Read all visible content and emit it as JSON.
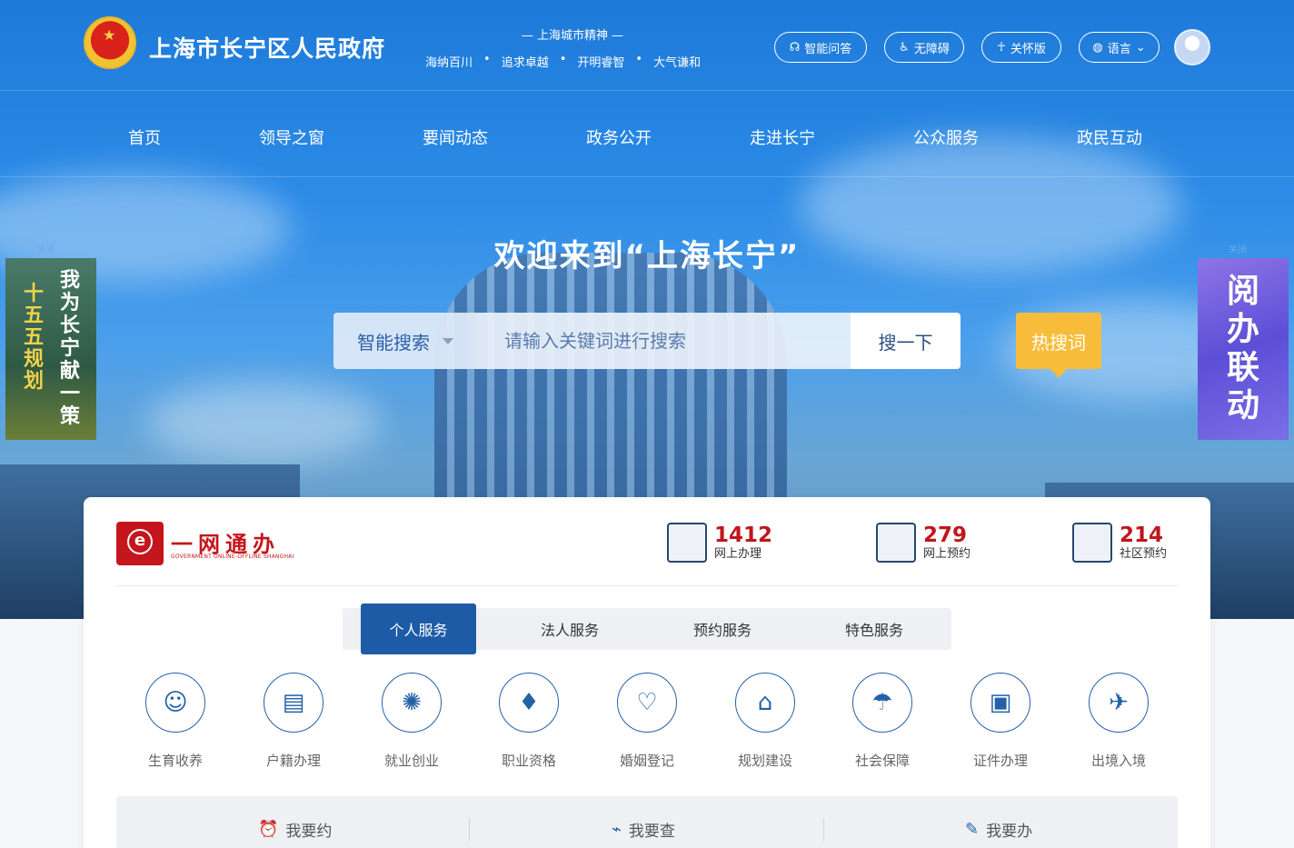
{
  "header": {
    "site_title": "上海市长宁区人民政府",
    "spirit_title": "— 上海城市精神 —",
    "spirit": [
      "海纳百川",
      "追求卓越",
      "开明睿智",
      "大气谦和"
    ],
    "tools": [
      {
        "label": "智能问答",
        "icon": "headset-icon"
      },
      {
        "label": "无障碍",
        "icon": "wheelchair-icon"
      },
      {
        "label": "关怀版",
        "icon": "elder-icon"
      },
      {
        "label": "语言",
        "icon": "globe-icon"
      }
    ]
  },
  "nav": [
    "首页",
    "领导之窗",
    "要闻动态",
    "政务公开",
    "走进长宁",
    "公众服务",
    "政民互动"
  ],
  "hero": {
    "welcome": "欢迎来到“上海长宁”",
    "search_type": "智能搜索",
    "search_placeholder": "请输入关键词进行搜索",
    "search_button": "搜一下",
    "hot_button": "热搜词"
  },
  "side_banners": {
    "close_label": "关闭",
    "left_col1": "十五五规划",
    "left_col2": "我为长宁献一策",
    "right_text": "阅办联动"
  },
  "ywtb": {
    "name": "一网通办",
    "subtitle": "GOVERNMENT ONLINE-OFFLINE SHANGHAI",
    "stats": [
      {
        "num": "1412",
        "label": "网上办理"
      },
      {
        "num": "279",
        "label": "网上预约"
      },
      {
        "num": "214",
        "label": "社区预约"
      }
    ],
    "tabs": [
      "个人服务",
      "法人服务",
      "预约服务",
      "特色服务"
    ],
    "services": [
      {
        "label": "生育收养",
        "icon": "baby-icon",
        "glyph": "☺"
      },
      {
        "label": "户籍办理",
        "icon": "id-card-icon",
        "glyph": "▤"
      },
      {
        "label": "就业创业",
        "icon": "lightbulb-icon",
        "glyph": "✺"
      },
      {
        "label": "职业资格",
        "icon": "tie-icon",
        "glyph": "♦"
      },
      {
        "label": "婚姻登记",
        "icon": "hearts-icon",
        "glyph": "♡"
      },
      {
        "label": "规划建设",
        "icon": "crane-icon",
        "glyph": "⌂"
      },
      {
        "label": "社会保障",
        "icon": "umbrella-icon",
        "glyph": "☂"
      },
      {
        "label": "证件办理",
        "icon": "badge-icon",
        "glyph": "▣"
      },
      {
        "label": "出境入境",
        "icon": "plane-icon",
        "glyph": "✈"
      }
    ],
    "quick": [
      {
        "label": "我要约",
        "icon": "alarm-icon",
        "glyph": "⏰"
      },
      {
        "label": "我要查",
        "icon": "chart-icon",
        "glyph": "⌁"
      },
      {
        "label": "我要办",
        "icon": "person-icon",
        "glyph": "✎"
      }
    ]
  }
}
